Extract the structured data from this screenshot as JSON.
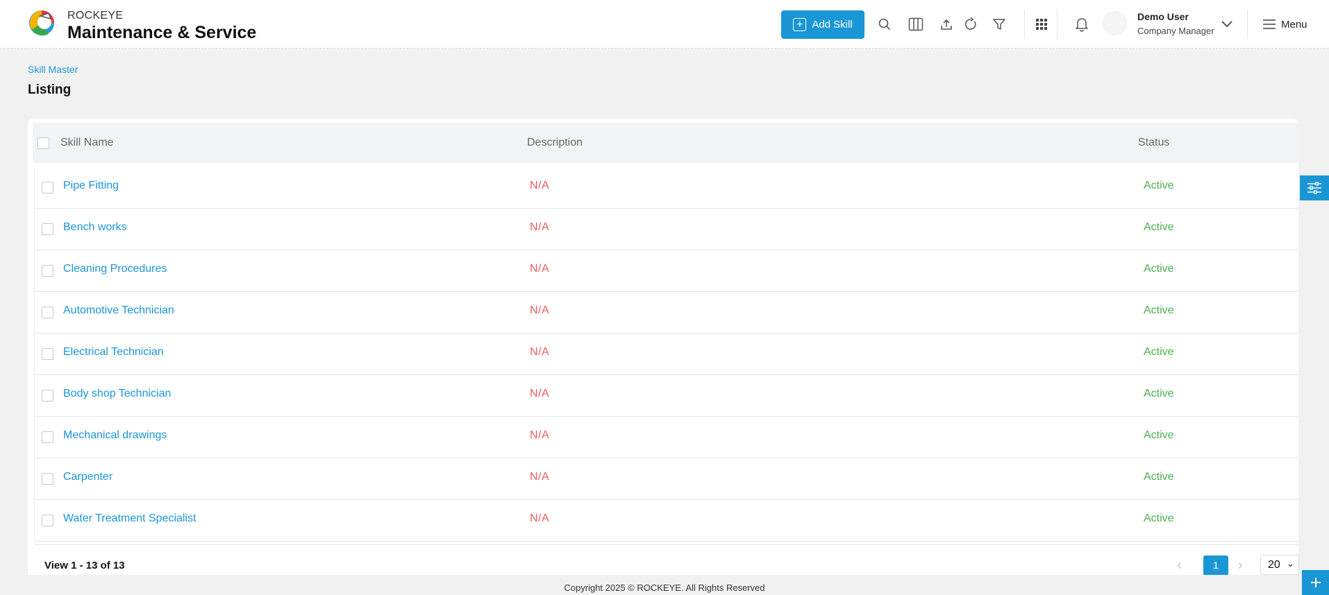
{
  "header": {
    "brand_sub": "ROCKEYE",
    "brand_main": "Maintenance & Service",
    "add_button_label": "Add Skill",
    "user_name": "Demo User",
    "user_role": "Company Manager",
    "menu_label": "Menu"
  },
  "page": {
    "breadcrumb": "Skill Master",
    "title": "Listing"
  },
  "table": {
    "columns": [
      "Skill Name",
      "Description",
      "Status"
    ],
    "rows": [
      {
        "name": "Pipe Fitting",
        "description": "N/A",
        "status": "Active"
      },
      {
        "name": "Bench works",
        "description": "N/A",
        "status": "Active"
      },
      {
        "name": "Cleaning Procedures",
        "description": "N/A",
        "status": "Active"
      },
      {
        "name": "Automotive Technician",
        "description": "N/A",
        "status": "Active"
      },
      {
        "name": "Electrical Technician",
        "description": "N/A",
        "status": "Active"
      },
      {
        "name": "Body shop Technician",
        "description": "N/A",
        "status": "Active"
      },
      {
        "name": "Mechanical drawings",
        "description": "N/A",
        "status": "Active"
      },
      {
        "name": "Carpenter",
        "description": "N/A",
        "status": "Active"
      },
      {
        "name": "Water Treatment Specialist",
        "description": "N/A",
        "status": "Active"
      }
    ]
  },
  "pagination": {
    "view_text": "View 1 - 13 of 13",
    "current_page": "1",
    "page_size": "20"
  },
  "footer": {
    "copyright": "Copyright 2025 © ROCKEYE. All Rights Reserved"
  },
  "colors": {
    "accent": "#1a96d4",
    "na_text": "#f05a5a",
    "active_status": "#4caf50"
  },
  "icons": [
    "brand-logo",
    "plus-icon",
    "search-icon",
    "columns-icon",
    "upload-icon",
    "refresh-icon",
    "filter-icon",
    "apps-grid-icon",
    "bell-icon",
    "chevron-down-icon",
    "hamburger-icon",
    "sliders-icon"
  ]
}
